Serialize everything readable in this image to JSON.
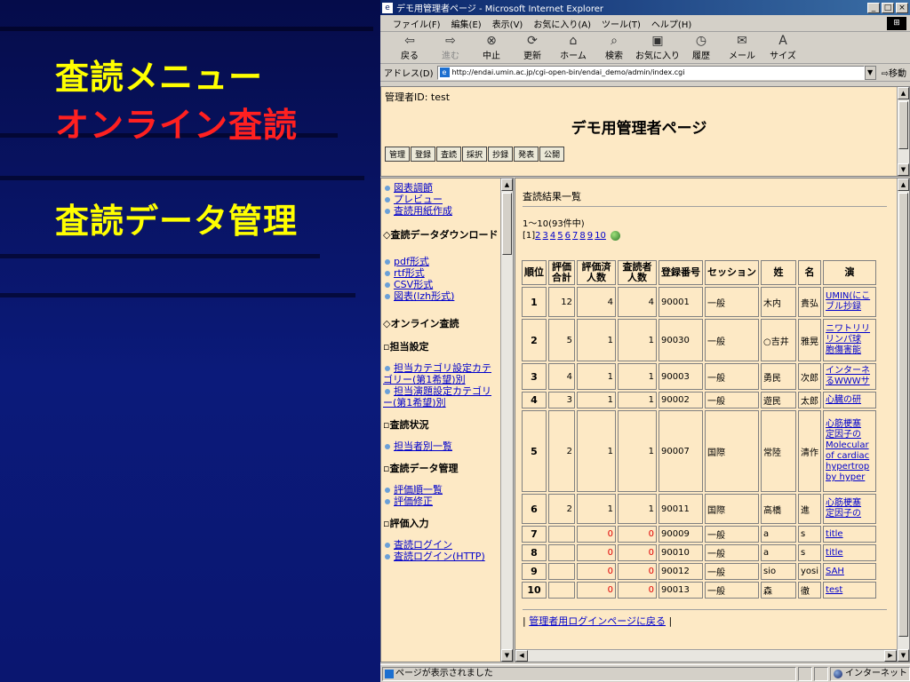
{
  "slide": {
    "title1": "査読メニュー",
    "title2": "オンライン査読",
    "title3": "査読データ管理",
    "color_title": "#ffff00",
    "color_highlight": "#ff2020"
  },
  "browser": {
    "window_title": "デモ用管理者ページ - Microsoft Internet Explorer",
    "menu": [
      "ファイル(F)",
      "編集(E)",
      "表示(V)",
      "お気に入り(A)",
      "ツール(T)",
      "ヘルプ(H)"
    ],
    "toolbar": {
      "back": "戻る",
      "forward": "進む",
      "stop": "中止",
      "refresh": "更新",
      "home": "ホーム",
      "search": "検索",
      "favorites": "お気に入り",
      "history": "履歴",
      "mail": "メール",
      "size": "サイズ"
    },
    "address_label": "アドレス(D)",
    "address": "http://endai.umin.ac.jp/cgi-open-bin/endai_demo/admin/index.cgi",
    "go_label": "移動",
    "status_text": "ページが表示されました",
    "zone_text": "インターネット"
  },
  "topframe": {
    "admin_id": "管理者ID: test",
    "page_title": "デモ用管理者ページ",
    "nav": [
      "管理",
      "登録",
      "査読",
      "採択",
      "抄録",
      "発表",
      "公開"
    ]
  },
  "leftmenu": {
    "links_a": [
      "図表調節",
      "プレビュー",
      "査読用紙作成"
    ],
    "heading_download": "◇査読データダウンロード",
    "links_b": [
      "pdf形式",
      "rtf形式",
      "CSV形式",
      "図表(lzh形式)"
    ],
    "heading_online": "◇オンライン査読",
    "sec_assign": "担当設定",
    "assign_cat": "担当カテゴリ設定カテゴリー(第1希望)別",
    "assign_topic": "担当演題設定カテゴリー(第1希望)別",
    "sec_status": "査読状況",
    "status_link": "担当者別一覧",
    "sec_data": "査読データ管理",
    "data_links": [
      "評価順一覧",
      "評価修正"
    ],
    "sec_input": "評価入力",
    "input_links": [
      "査読ログイン",
      "査読ログイン(HTTP)"
    ]
  },
  "results": {
    "heading": "査読結果一覧",
    "count": "1～10(93件中)",
    "current_page": "[1]",
    "pages": [
      "2",
      "3",
      "4",
      "5",
      "6",
      "7",
      "8",
      "9",
      "10"
    ],
    "columns": [
      "順位",
      "評価合計",
      "評価済人数",
      "査読者人数",
      "登録番号",
      "セッション",
      "姓",
      "名",
      "演"
    ],
    "rows": [
      {
        "rank": "1",
        "total": "12",
        "done": "4",
        "reviewers": "4",
        "reg": "90001",
        "session": "一般",
        "last": "木内",
        "first": "貴弘",
        "title1": "UMIN(にこ",
        "title2": "ブル抄録"
      },
      {
        "rank": "2",
        "total": "5",
        "done": "1",
        "reviewers": "1",
        "reg": "90030",
        "session": "一般",
        "last": "○吉井",
        "first": "雅晃",
        "title1": "ニワトリリ",
        "title2": "リンパ球",
        "title3": "胞傷害能"
      },
      {
        "rank": "3",
        "total": "4",
        "done": "1",
        "reviewers": "1",
        "reg": "90003",
        "session": "一般",
        "last": "勇民",
        "first": "次郎",
        "title1": "インターネ",
        "title2": "るWWWサ"
      },
      {
        "rank": "4",
        "total": "3",
        "done": "1",
        "reviewers": "1",
        "reg": "90002",
        "session": "一般",
        "last": "遊民",
        "first": "太郎",
        "title1": "心臓の研"
      },
      {
        "rank": "5",
        "total": "2",
        "done": "1",
        "reviewers": "1",
        "reg": "90007",
        "session": "国際",
        "last": "常陸",
        "first": "清作",
        "title1": "心筋梗塞",
        "title2": "定因子の",
        "title3": "Molecular",
        "title4": "of cardiac",
        "title5": "hypertrop",
        "title6": "by hyper"
      },
      {
        "rank": "6",
        "total": "2",
        "done": "1",
        "reviewers": "1",
        "reg": "90011",
        "session": "国際",
        "last": "高橋",
        "first": "進",
        "title1": "心筋梗塞",
        "title2": "定因子の"
      },
      {
        "rank": "7",
        "total": "",
        "done": "0",
        "reviewers": "0",
        "reg": "90009",
        "session": "一般",
        "last": "a",
        "first": "s",
        "title1": "title"
      },
      {
        "rank": "8",
        "total": "",
        "done": "0",
        "reviewers": "0",
        "reg": "90010",
        "session": "一般",
        "last": "a",
        "first": "s",
        "title1": "title"
      },
      {
        "rank": "9",
        "total": "",
        "done": "0",
        "reviewers": "0",
        "reg": "90012",
        "session": "一般",
        "last": "sio",
        "first": "yosi",
        "title1": "SAH"
      },
      {
        "rank": "10",
        "total": "",
        "done": "0",
        "reviewers": "0",
        "reg": "90013",
        "session": "一般",
        "last": "森",
        "first": "徹",
        "title1": "test"
      }
    ],
    "return_link": "管理者用ログインページに戻る",
    "return_left": "|",
    "return_right": "|"
  }
}
